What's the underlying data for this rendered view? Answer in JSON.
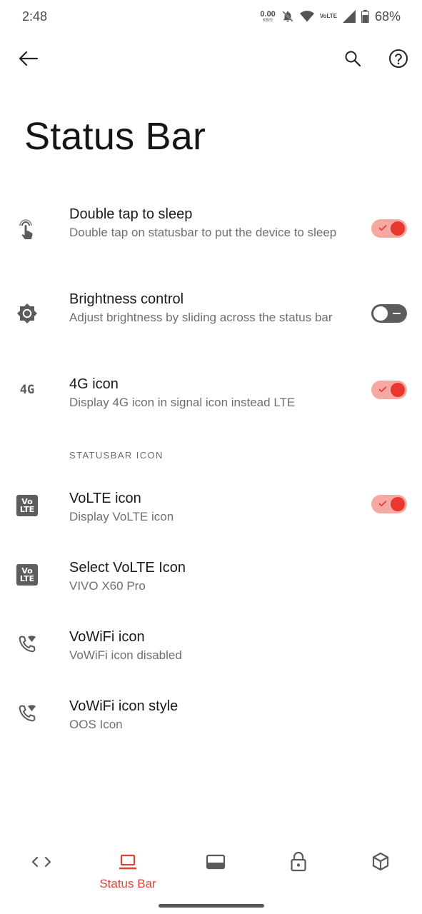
{
  "status_bar": {
    "time": "2:48",
    "net_speed_value": "0.00",
    "net_speed_unit": "KB/S",
    "volte_top": "Vo",
    "volte_bottom": "LTE",
    "battery_percent": "68%",
    "icons": [
      "dnd-bell-off-icon",
      "wifi-icon",
      "volte-icon",
      "signal-icon",
      "battery-icon"
    ]
  },
  "app_bar": {
    "back_icon": "arrow-back-icon",
    "search_icon": "search-icon",
    "help_icon": "help-icon"
  },
  "page": {
    "title": "Status Bar"
  },
  "settings": [
    {
      "title": "Double tap to sleep",
      "summary": "Double tap on statusbar to put the device to sleep",
      "icon": "touch-tap-icon",
      "toggle": "on"
    },
    {
      "title": "Brightness control",
      "summary": "Adjust brightness by sliding across the status bar",
      "icon": "brightness-icon",
      "toggle": "off"
    },
    {
      "title": "4G icon",
      "summary": "Display 4G icon in signal icon instead LTE",
      "icon_text": "4G",
      "toggle": "on"
    }
  ],
  "section_header": "STATUSBAR ICON",
  "statusbar_icon_settings": [
    {
      "title": "VoLTE icon",
      "summary": "Display VoLTE icon",
      "icon_top": "Vo",
      "icon_bottom": "LTE",
      "toggle": "on"
    },
    {
      "title": "Select VoLTE Icon",
      "summary": "VIVO X60 Pro",
      "icon_top": "Vo",
      "icon_bottom": "LTE"
    },
    {
      "title": "VoWiFi icon",
      "summary": "VoWiFi icon disabled",
      "icon": "wifi-call-icon"
    },
    {
      "title": "VoWiFi icon style",
      "summary": "OOS Icon",
      "icon": "wifi-call-icon"
    }
  ],
  "bottom_nav": {
    "items": [
      {
        "icon": "code-icon"
      },
      {
        "icon": "laptop-icon",
        "label": "Status Bar",
        "active": true
      },
      {
        "icon": "window-icon"
      },
      {
        "icon": "lock-icon"
      },
      {
        "icon": "cube-icon"
      }
    ]
  },
  "colors": {
    "accent": "#e8372f",
    "accent_track": "#f6a8a2",
    "active_label": "#d84437",
    "off_track": "#5c5c5c"
  }
}
